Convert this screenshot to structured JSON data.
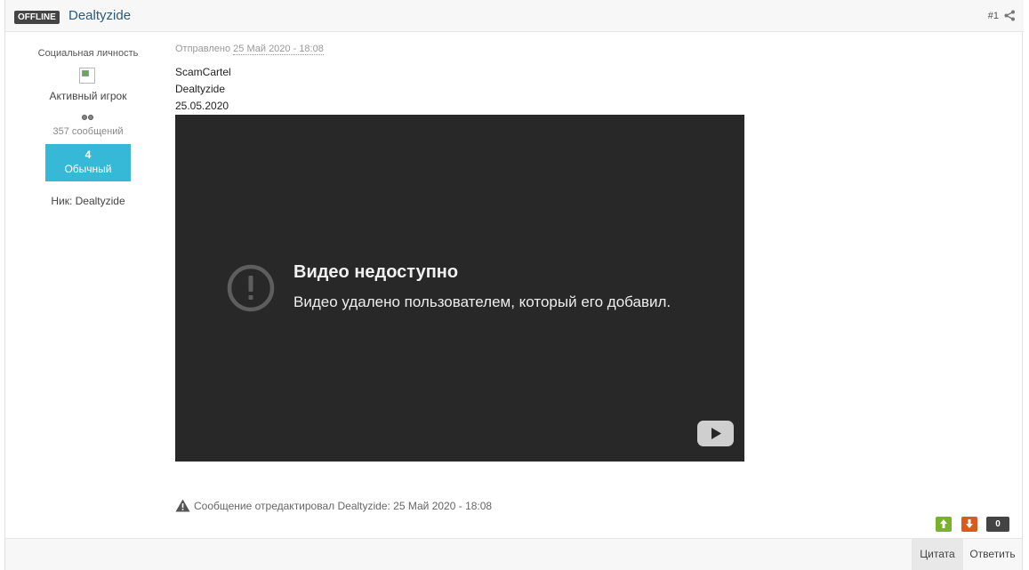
{
  "header": {
    "status_badge": "OFFLINE",
    "author_name": "Dealtyzide",
    "post_number": "#1"
  },
  "author": {
    "title": "Социальная личность",
    "group": "Активный игрок",
    "post_count": "357 сообщений",
    "reputation": {
      "value": "4",
      "label": "Обычный"
    },
    "nick": "Ник: Dealtyzide"
  },
  "post": {
    "date_prefix": "Отправлено",
    "date": "25 Май 2020 - 18:08",
    "lines": [
      "ScamCartel",
      "Dealtyzide",
      "25.05.2020"
    ],
    "video": {
      "title": "Видео недоступно",
      "message": "Видео удалено пользователем, который его добавил."
    },
    "edit_note": "Сообщение отредактировал Dealtyzide: 25 Май 2020 - 18:08"
  },
  "rating": {
    "count": "0"
  },
  "footer": {
    "quote_label": "Цитата",
    "reply_label": "Ответить"
  },
  "colors": {
    "reputation_bg": "#35b9d7",
    "vote_up": "#7ab22c",
    "vote_down": "#d85a1e",
    "video_bg": "#282828",
    "author_link": "#2b5a7e"
  }
}
